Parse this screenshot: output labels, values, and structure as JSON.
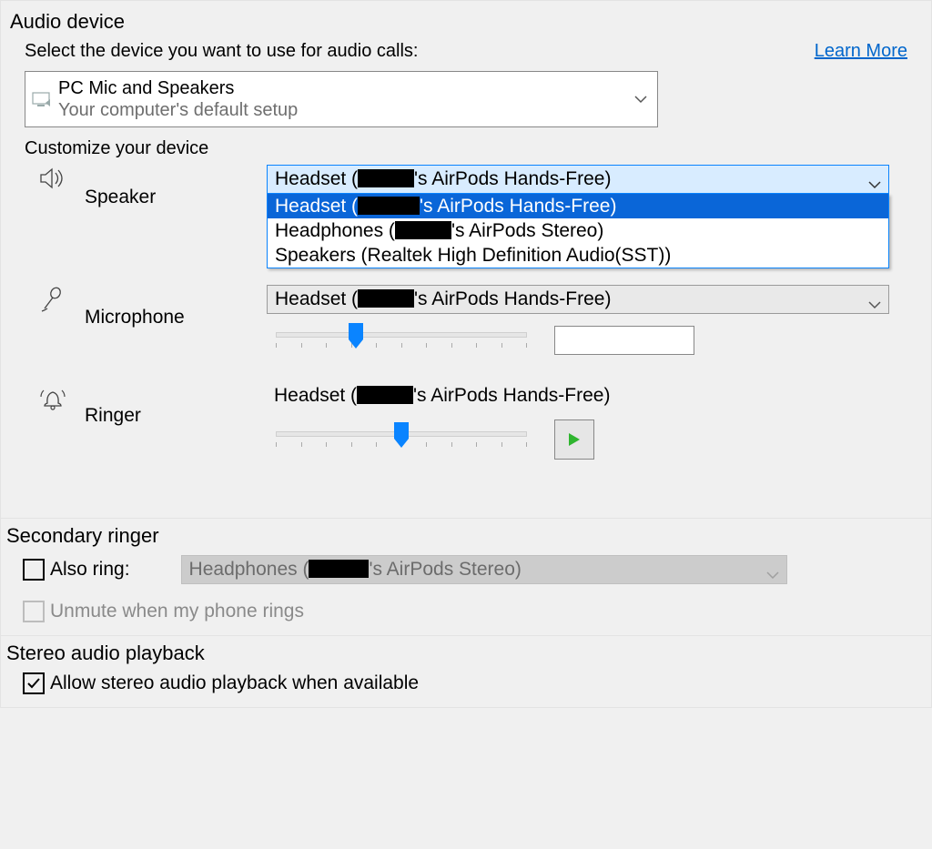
{
  "audio_device": {
    "title": "Audio device",
    "prompt": "Select the device you want to use for audio calls:",
    "learn_more": "Learn More",
    "selected_title": "PC Mic and Speakers",
    "selected_subtitle": "Your computer's default setup"
  },
  "customize": {
    "title": "Customize your device",
    "speaker": {
      "label": "Speaker",
      "value_prefix": "Headset (",
      "value_suffix": "'s AirPods Hands-Free)",
      "options": [
        {
          "prefix": "Headset (",
          "suffix": "'s AirPods Hands-Free)",
          "redacted": true
        },
        {
          "prefix": "Headphones (",
          "suffix": "'s AirPods Stereo)",
          "redacted": true
        },
        {
          "prefix": "Speakers (Realtek High Definition Audio(SST))",
          "suffix": "",
          "redacted": false
        }
      ]
    },
    "microphone": {
      "label": "Microphone",
      "value_prefix": "Headset (",
      "value_suffix": "'s AirPods Hands-Free)",
      "level_percent": 32
    },
    "ringer": {
      "label": "Ringer",
      "value_prefix": "Headset (",
      "value_suffix": "'s AirPods Hands-Free)",
      "level_percent": 50
    }
  },
  "secondary_ringer": {
    "title": "Secondary ringer",
    "also_ring_label": "Also ring:",
    "also_ring_checked": false,
    "device_prefix": "Headphones (",
    "device_suffix": "'s AirPods Stereo)",
    "unmute_label": "Unmute when my phone rings",
    "unmute_checked": false
  },
  "stereo": {
    "title": "Stereo audio playback",
    "allow_label": "Allow stereo audio playback when available",
    "allow_checked": true
  }
}
